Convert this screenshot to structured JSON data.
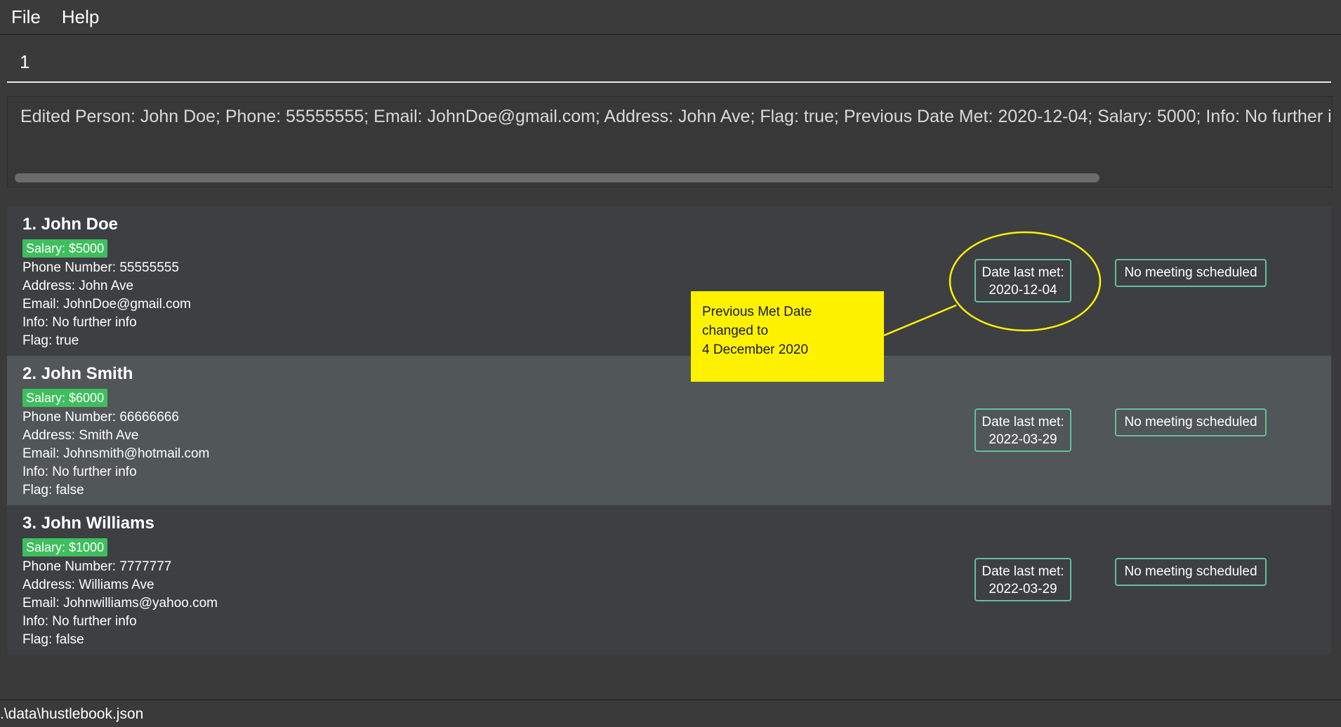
{
  "menu": {
    "file": "File",
    "help": "Help"
  },
  "command": {
    "value": "1"
  },
  "result": {
    "text": "Edited Person: John Doe; Phone: 55555555; Email: JohnDoe@gmail.com; Address: John Ave; Flag: true; Previous Date Met: 2020-12-04; Salary: 5000; Info: No further info: N"
  },
  "persons": [
    {
      "index_name": "1.  John Doe",
      "salary": "Salary: $5000",
      "phone": "Phone Number: 55555555",
      "address": "Address: John Ave",
      "email": "Email: JohnDoe@gmail.com",
      "info": "Info: No further info",
      "flag": "Flag: true",
      "date_label": "Date last met:",
      "date_value": "2020-12-04",
      "meeting": "No meeting scheduled"
    },
    {
      "index_name": "2.  John Smith",
      "salary": "Salary: $6000",
      "phone": "Phone Number: 66666666",
      "address": "Address: Smith Ave",
      "email": "Email: Johnsmith@hotmail.com",
      "info": "Info: No further info",
      "flag": "Flag: false",
      "date_label": "Date last met:",
      "date_value": "2022-03-29",
      "meeting": "No meeting scheduled"
    },
    {
      "index_name": "3.  John Williams",
      "salary": "Salary: $1000",
      "phone": "Phone Number: 7777777",
      "address": "Address: Williams Ave",
      "email": "Email: Johnwilliams@yahoo.com",
      "info": "Info: No further info",
      "flag": "Flag: false",
      "date_label": "Date last met:",
      "date_value": "2022-03-29",
      "meeting": "No meeting scheduled"
    }
  ],
  "annotation": {
    "line1": "Previous Met Date",
    "line2": "changed to",
    "line3": "4 December 2020"
  },
  "status": {
    "path": ".\\data\\hustlebook.json"
  },
  "colors": {
    "salary_tag": "#3fbe5e",
    "box_border": "#63c09a",
    "annotation": "#fff200",
    "highlight_ellipse": "#fff200"
  }
}
